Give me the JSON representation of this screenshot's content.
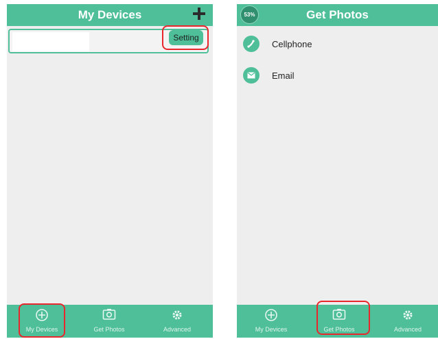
{
  "left_screen": {
    "title": "My Devices",
    "add_icon": "plus-icon",
    "setting_label": "Setting",
    "tabs": [
      {
        "label": "My Devices",
        "icon": "plus-circle-icon"
      },
      {
        "label": "Get Photos",
        "icon": "camera-icon"
      },
      {
        "label": "Advanced",
        "icon": "gear-icon"
      }
    ]
  },
  "right_screen": {
    "title": "Get Photos",
    "battery_percent": "53%",
    "items": [
      {
        "label": "Cellphone",
        "icon": "phone-icon"
      },
      {
        "label": "Email",
        "icon": "mail-icon"
      }
    ],
    "tabs": [
      {
        "label": "My Devices",
        "icon": "plus-circle-icon"
      },
      {
        "label": "Get Photos",
        "icon": "camera-icon"
      },
      {
        "label": "Advanced",
        "icon": "gear-icon"
      }
    ]
  },
  "colors": {
    "accent": "#4fbf99",
    "highlight": "#e8262b",
    "background": "#eeeeee"
  }
}
